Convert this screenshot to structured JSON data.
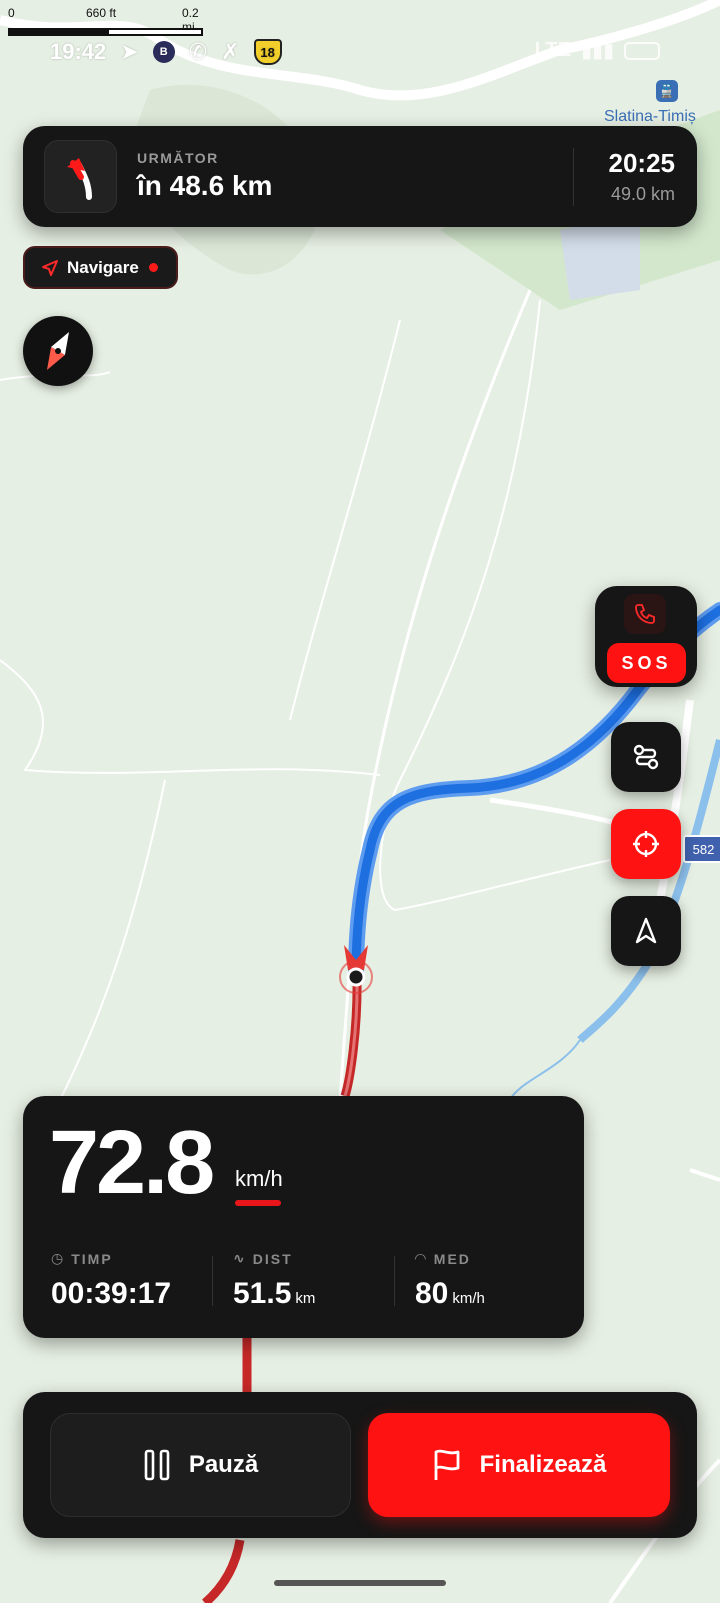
{
  "map": {
    "scale": {
      "zero": "0",
      "feet": "660 ft",
      "miles": "0.2 mi"
    },
    "station_label": "Slatina-Timiș",
    "road_number": "582"
  },
  "status_bar": {
    "time": "19:42",
    "badge": "B",
    "shield": "18",
    "network": "LTE"
  },
  "next_turn": {
    "label": "URMĂTOR",
    "distance": "în 48.6 km",
    "eta": "20:25",
    "remaining": "49.0 km"
  },
  "nav_pill": {
    "label": "Navigare"
  },
  "sos": {
    "label": "SOS"
  },
  "stats": {
    "speed": "72.8",
    "speed_unit": "km/h",
    "time_label": "TIMP",
    "time_value": "00:39:17",
    "dist_label": "DIST",
    "dist_value": "51.5",
    "dist_unit": "km",
    "avg_label": "MED",
    "avg_value": "80",
    "avg_unit": "km/h"
  },
  "actions": {
    "pause": "Pauză",
    "finish": "Finalizează"
  },
  "colors": {
    "accent": "#ff1212",
    "route": "#2f7be8",
    "track": "#d32f2f",
    "panel": "#161616"
  }
}
